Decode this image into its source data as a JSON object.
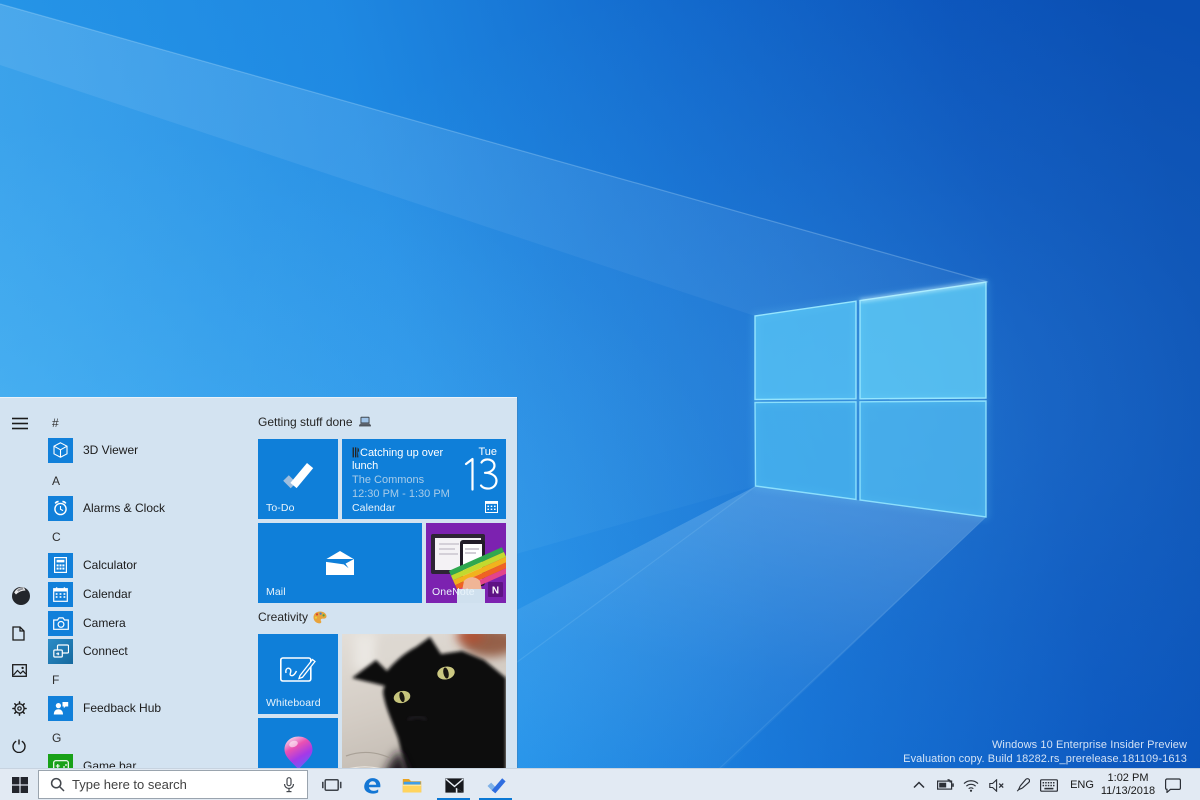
{
  "desktop": {
    "watermark": {
      "line1": "Windows 10 Enterprise Insider Preview",
      "line2": "Evaluation copy. Build 18282.rs_prerelease.181109-1613"
    }
  },
  "colors": {
    "accent_blue": "#0f7fd9",
    "menu_background": "#d3e3f1",
    "taskbar_background": "#e2eaf3",
    "onenote_purple": "#7c22b0",
    "gamebar_green": "#17a017",
    "run_indicator_blue": "#0b78d4"
  },
  "start_menu": {
    "app_list": [
      {
        "type": "letter",
        "label": "#"
      },
      {
        "type": "app",
        "label": "3D Viewer"
      },
      {
        "type": "letter",
        "label": "A"
      },
      {
        "type": "app",
        "label": "Alarms & Clock"
      },
      {
        "type": "letter",
        "label": "C"
      },
      {
        "type": "app",
        "label": "Calculator"
      },
      {
        "type": "app",
        "label": "Calendar"
      },
      {
        "type": "app",
        "label": "Camera"
      },
      {
        "type": "app",
        "label": "Connect"
      },
      {
        "type": "letter",
        "label": "F"
      },
      {
        "type": "app",
        "label": "Feedback Hub"
      },
      {
        "type": "letter",
        "label": "G"
      },
      {
        "type": "app",
        "label": "Game bar"
      }
    ],
    "groups": {
      "productivity": {
        "title": "Getting stuff done"
      },
      "creativity": {
        "title": "Creativity"
      }
    },
    "tiles": {
      "todo": {
        "label": "To-Do"
      },
      "calendar": {
        "label": "Calendar",
        "event_title": "Catching up over lunch",
        "event_location": "The Commons",
        "event_time": "12:30 PM - 1:30 PM",
        "day": "Tue",
        "date": "13"
      },
      "mail": {
        "label": "Mail"
      },
      "onenote": {
        "label": "OneNote",
        "logo_letter": "N"
      },
      "whiteboard": {
        "label": "Whiteboard"
      }
    }
  },
  "taskbar": {
    "search": {
      "placeholder": "Type here to search"
    },
    "tray": {
      "language": "ENG",
      "time": "1:02 PM",
      "date": "11/13/2018"
    }
  }
}
